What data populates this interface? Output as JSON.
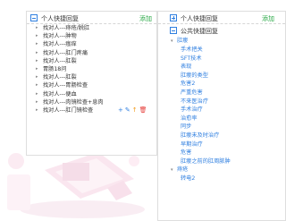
{
  "left_panel": {
    "header_title": "个人快捷回复",
    "add_label": "添加",
    "items": [
      "找对人---痔疮/脱肛",
      "找对人---肿物",
      "找对人---瘙痒",
      "找对人---肛门疼痛",
      "找对人---肛裂",
      "胃肠18问",
      "找对人---肛裂",
      "找对人---胃肠检查",
      "找对人---便血",
      "找对人---肉镜检查+息肉",
      "找对人---肛门镜检查"
    ],
    "row_actions": {
      "add": "+",
      "edit": "✎",
      "up": "↑",
      "delete": "🗑"
    }
  },
  "right_panel": {
    "personal_title": "个人快捷回复",
    "add_label": "添加",
    "public_title": "公共快捷回复",
    "category_1": "肛瘘",
    "items": [
      "手术把关",
      "SFT技术",
      "表现",
      "肛瘘的类型",
      "危害2",
      "严重危害",
      "不来医治疗",
      "手术治疗",
      "治愈率",
      "同步",
      "肛瘘未及时治疗",
      "早期治疗",
      "危害",
      "肛瘘之前的肛周脓肿"
    ],
    "category_2": "痔疮",
    "category_2_first": "转电2"
  },
  "colors": {
    "accent": "#2f7fe0",
    "add_green": "#27a844"
  }
}
